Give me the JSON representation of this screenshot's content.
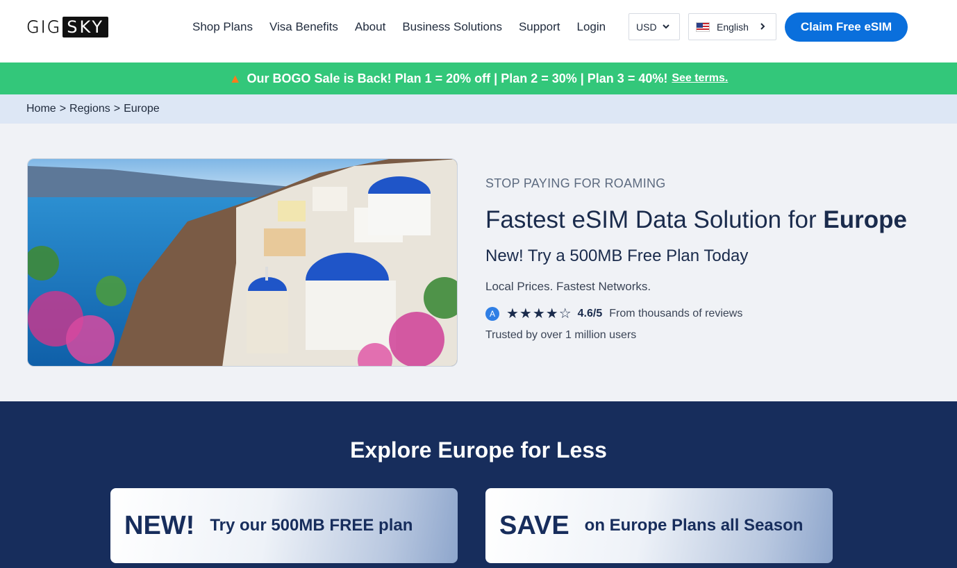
{
  "header": {
    "logo_left": "GIG",
    "logo_right": "SKY",
    "nav": [
      "Shop Plans",
      "Visa Benefits",
      "About",
      "Business Solutions",
      "Support",
      "Login"
    ],
    "currency": "USD",
    "language": "English",
    "cta": "Claim Free eSIM"
  },
  "promo": {
    "text": "Our BOGO Sale is Back! Plan 1 = 20% off | Plan 2 = 30% | Plan 3 = 40%!",
    "link": "See terms."
  },
  "breadcrumb": [
    "Home",
    "Regions",
    "Europe"
  ],
  "hero": {
    "eyebrow": "STOP PAYING FOR ROAMING",
    "headline_prefix": "Fastest eSIM Data Solution for",
    "headline_bold": "Europe",
    "subheadline": "New! Try a 500MB Free Plan Today",
    "tagline": "Local Prices. Fastest Networks.",
    "rating_score": "4.6/5",
    "rating_value": 4.6,
    "rating_note": "From thousands of reviews",
    "trusted": "Trusted by over 1 million users"
  },
  "explore": {
    "title": "Explore Europe for Less",
    "cards": [
      {
        "big": "NEW!",
        "small": "Try our 500MB FREE plan"
      },
      {
        "big": "SAVE",
        "small": "on Europe Plans all Season"
      }
    ]
  },
  "colors": {
    "brand_blue": "#0a6fdc",
    "promo_green": "#33c77a",
    "navy": "#172d5c"
  }
}
